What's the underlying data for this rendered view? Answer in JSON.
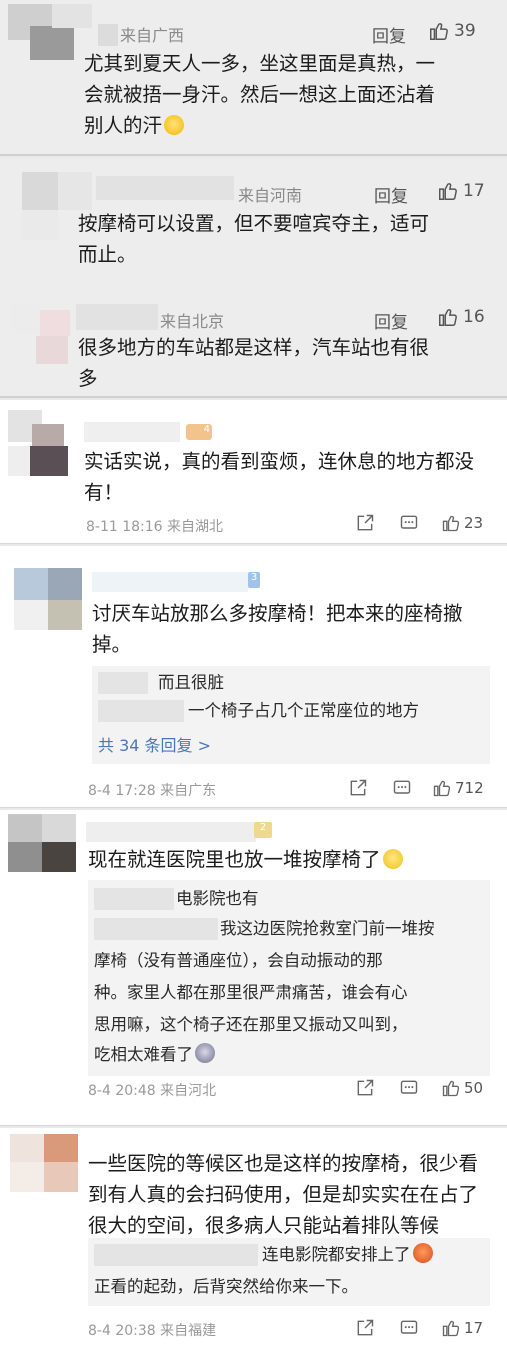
{
  "comments_top": [
    {
      "region": "来自广西",
      "reply": "回复",
      "likes": "39",
      "lines": [
        "尤其到夏天人一多，坐这里面是真热，一",
        "会就被捂一身汗。然后一想这上面还沾着",
        "别人的汗"
      ]
    },
    {
      "region": "来自河南",
      "reply": "回复",
      "likes": "17",
      "lines": [
        "按摩椅可以设置，但不要喧宾夺主，适可",
        "而止。"
      ]
    },
    {
      "region": "来自北京",
      "reply": "回复",
      "likes": "16",
      "lines": [
        "很多地方的车站都是这样，汽车站也有很",
        "多"
      ]
    }
  ],
  "cards": [
    {
      "badge": "4",
      "lines": [
        "实话实说，真的看到蛮烦，连休息的地方都没",
        "有！"
      ],
      "time": "8-11 18:16  来自湖北",
      "likes": "23"
    },
    {
      "badge": "3",
      "lines": [
        "讨厌车站放那么多按摩椅！把本来的座椅撤",
        "掉。"
      ],
      "sub": [
        "而且很脏",
        "一个椅子占几个正常座位的地方"
      ],
      "more": "共 34 条回复 >",
      "time": "8-4 17:28  来自广东",
      "likes": "712"
    },
    {
      "badge": "2",
      "lines": [
        "现在就连医院里也放一堆按摩椅了"
      ],
      "sub": [
        "电影院也有",
        "我这边医院抢救室门前一堆按",
        "摩椅（没有普通座位），会自动振动的那",
        "种。家里人都在那里很严肃痛苦，谁会有心",
        "思用嘛，这个椅子还在那里又振动又叫到，",
        "吃相太难看了"
      ],
      "time": "8-4 20:48  来自河北",
      "likes": "50"
    },
    {
      "badge": "",
      "lines": [
        "一些医院的等候区也是这样的按摩椅，很少看",
        "到有人真的会扫码使用，但是却实实在在占了",
        "很大的空间，很多病人只能站着排队等候"
      ],
      "sub": [
        "连电影院都安排上了",
        "正看的起劲，后背突然给你来一下。"
      ],
      "time": "8-4 20:38  来自福建",
      "likes": "17"
    }
  ],
  "icons": [
    "thumbs-up-icon",
    "share-icon",
    "comment-icon"
  ],
  "colors": {
    "link": "#4a78b5",
    "meta": "#8a8a8a"
  }
}
